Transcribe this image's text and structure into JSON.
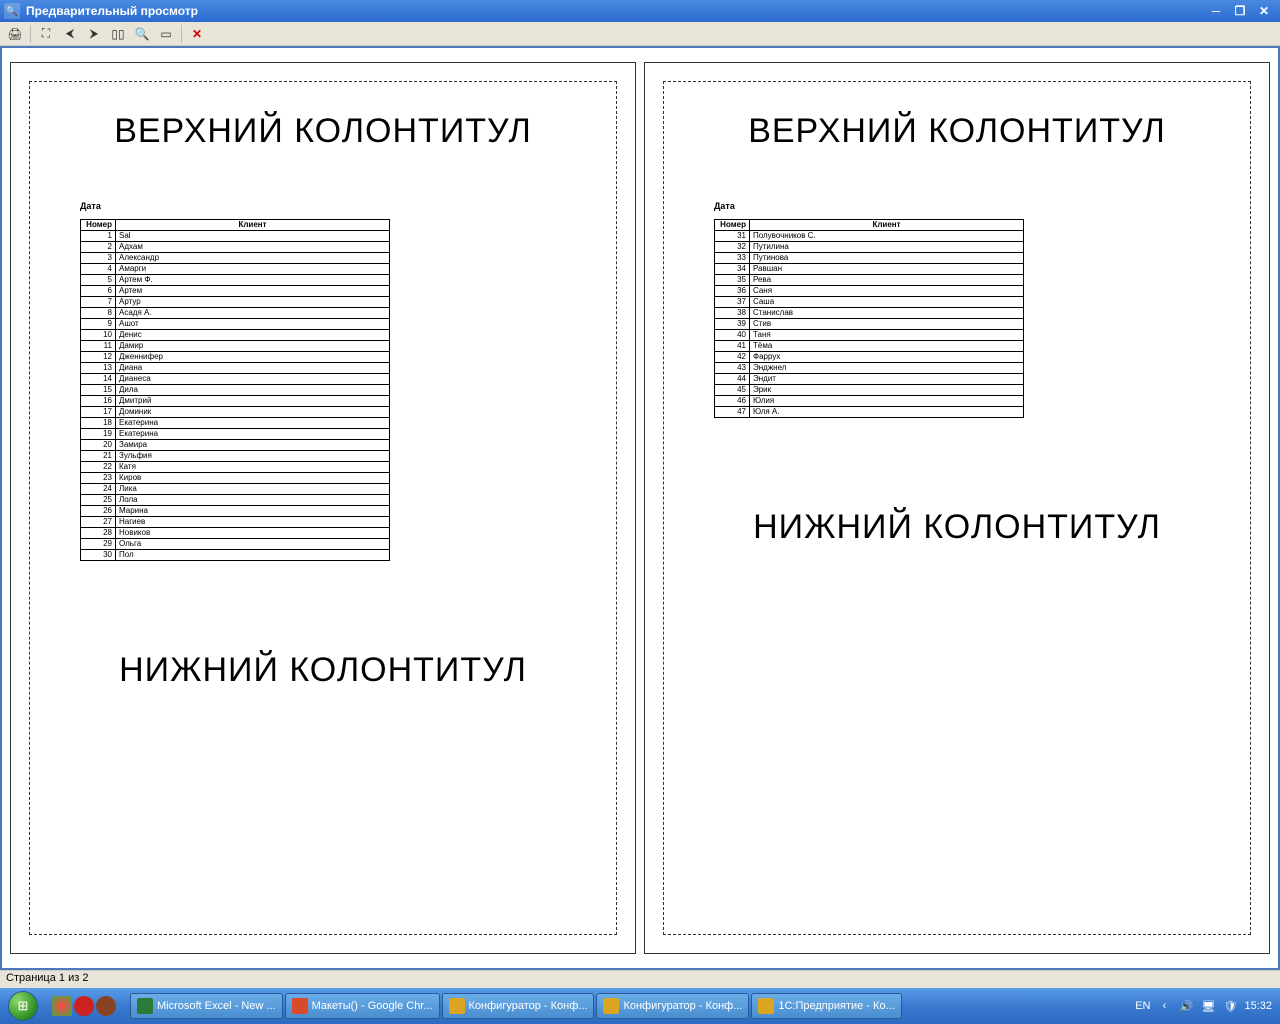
{
  "window": {
    "title": "Предварительный просмотр"
  },
  "page_content": {
    "header": "ВЕРХНИЙ КОЛОНТИТУЛ",
    "footer": "НИЖНИЙ КОЛОНТИТУЛ",
    "date_label": "Дата",
    "col_number": "Номер",
    "col_client": "Клиент"
  },
  "rows_page1": [
    {
      "n": "1",
      "name": "Sal"
    },
    {
      "n": "2",
      "name": "Адхам"
    },
    {
      "n": "3",
      "name": "Александр"
    },
    {
      "n": "4",
      "name": "Амарги"
    },
    {
      "n": "5",
      "name": "Артем Ф."
    },
    {
      "n": "6",
      "name": "Артем"
    },
    {
      "n": "7",
      "name": "Артур"
    },
    {
      "n": "8",
      "name": "Асадя А."
    },
    {
      "n": "9",
      "name": "Ашот"
    },
    {
      "n": "10",
      "name": "Денис"
    },
    {
      "n": "11",
      "name": "Дамир"
    },
    {
      "n": "12",
      "name": "Дженнифер"
    },
    {
      "n": "13",
      "name": "Диана"
    },
    {
      "n": "14",
      "name": "Дианеса"
    },
    {
      "n": "15",
      "name": "Дила"
    },
    {
      "n": "16",
      "name": "Дмитрий"
    },
    {
      "n": "17",
      "name": "Доминик"
    },
    {
      "n": "18",
      "name": "Екатерина"
    },
    {
      "n": "19",
      "name": "Екатерина"
    },
    {
      "n": "20",
      "name": "Замира"
    },
    {
      "n": "21",
      "name": "Зульфия"
    },
    {
      "n": "22",
      "name": "Катя"
    },
    {
      "n": "23",
      "name": "Киров"
    },
    {
      "n": "24",
      "name": "Лика"
    },
    {
      "n": "25",
      "name": "Лола"
    },
    {
      "n": "26",
      "name": "Марина"
    },
    {
      "n": "27",
      "name": "Нагиев"
    },
    {
      "n": "28",
      "name": "Новиков"
    },
    {
      "n": "29",
      "name": "Ольга"
    },
    {
      "n": "30",
      "name": "Пол"
    }
  ],
  "rows_page2": [
    {
      "n": "31",
      "name": "Полувочников С."
    },
    {
      "n": "32",
      "name": "Путилина"
    },
    {
      "n": "33",
      "name": "Путинова"
    },
    {
      "n": "34",
      "name": "Равшан"
    },
    {
      "n": "35",
      "name": "Рева"
    },
    {
      "n": "36",
      "name": "Саня"
    },
    {
      "n": "37",
      "name": "Саша"
    },
    {
      "n": "38",
      "name": "Станислав"
    },
    {
      "n": "39",
      "name": "Стив"
    },
    {
      "n": "40",
      "name": "Таня"
    },
    {
      "n": "41",
      "name": "Тёма"
    },
    {
      "n": "42",
      "name": "Фаррух"
    },
    {
      "n": "43",
      "name": "Энджнел"
    },
    {
      "n": "44",
      "name": "Эндит"
    },
    {
      "n": "45",
      "name": "Эрик"
    },
    {
      "n": "46",
      "name": "Юлия"
    },
    {
      "n": "47",
      "name": "Юля А."
    }
  ],
  "status": {
    "page_info": "Страница 1 из 2"
  },
  "taskbar": {
    "items": [
      {
        "label": "Microsoft Excel - New ...",
        "color": "#2a7a3a"
      },
      {
        "label": "Макеты() - Google Chr...",
        "color": "#d84a2a"
      },
      {
        "label": "Конфигуратор - Конф...",
        "color": "#daa520"
      },
      {
        "label": "Конфигуратор - Конф...",
        "color": "#daa520"
      },
      {
        "label": "1С:Предприятие - Ко...",
        "color": "#daa520"
      }
    ],
    "lang": "EN",
    "clock": "15:32"
  }
}
